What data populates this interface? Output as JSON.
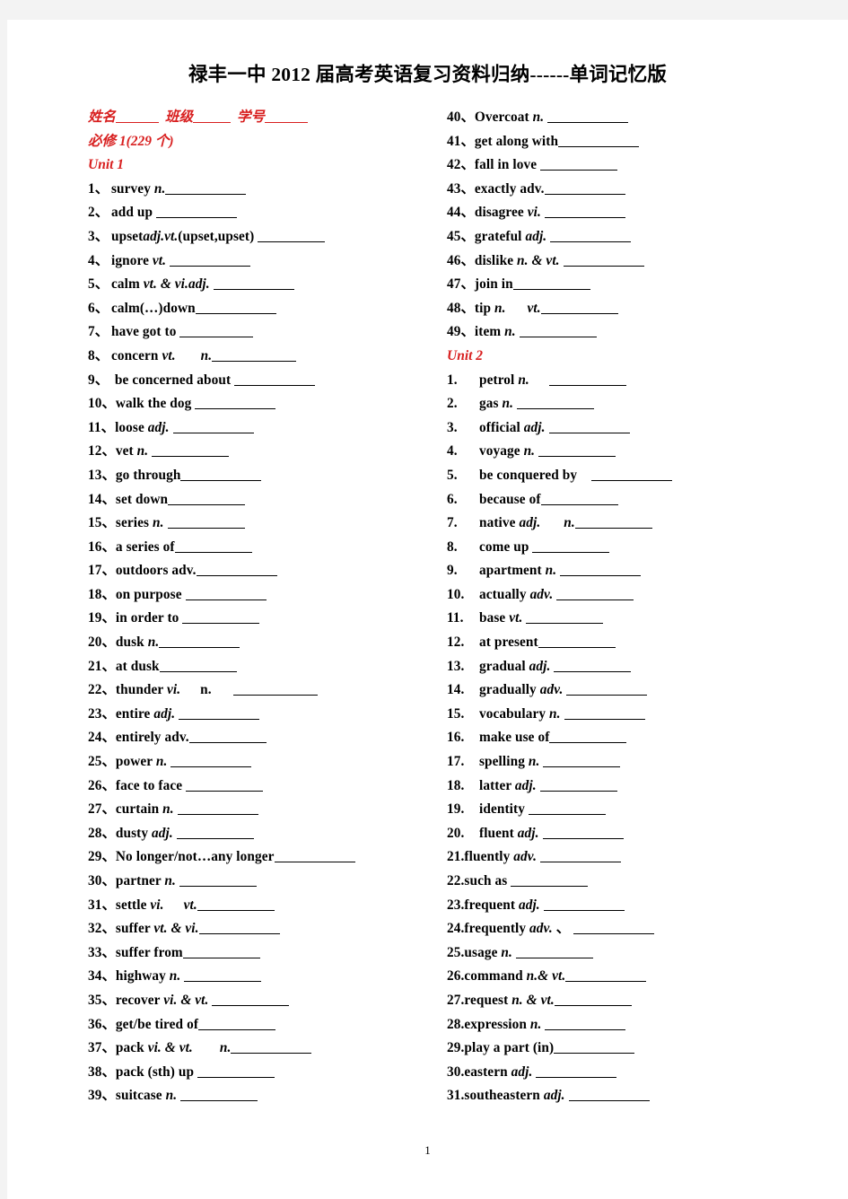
{
  "document": {
    "title": "禄丰一中 2012 届高考英语复习资料归纳------单词记忆版",
    "page_number": "1"
  },
  "meta": {
    "name_label": "姓名",
    "class_label": "班级",
    "student_id_label": "学号",
    "book_label": "必修 1(229 个)"
  },
  "units": {
    "unit1_label": "Unit 1",
    "unit2_label": "Unit 2"
  },
  "colors": {
    "accent_red": "#d81f1f",
    "text_black": "#000000",
    "page_white": "#ffffff",
    "surround_gray": "#f3f3f3"
  },
  "left_column": [
    {
      "num": "1、",
      "word": "survey ",
      "pos": "n.",
      "tail": "",
      "blank": 90,
      "gap": 0,
      "style": "dun"
    },
    {
      "num": "2、",
      "word": "add up ",
      "pos": "",
      "tail": "",
      "blank": 90,
      "gap": 0,
      "style": "dun"
    },
    {
      "num": "3、",
      "word": "upset",
      "pos": "adj.vt.",
      "tail": "(upset,upset) ",
      "blank": 75,
      "gap": 0,
      "style": "dun"
    },
    {
      "num": "4、",
      "word": "ignore ",
      "pos": "vt.",
      "tail": "",
      "blank": 90,
      "gap": 4,
      "style": "dun"
    },
    {
      "num": "5、",
      "word": "calm ",
      "pos": "vt. & vi.adj.",
      "tail": "",
      "blank": 90,
      "gap": 4,
      "style": "dun"
    },
    {
      "num": " 6、",
      "word": "calm(…)down",
      "pos": "",
      "tail": "",
      "blank": 90,
      "gap": 0,
      "style": "dun"
    },
    {
      "num": "7、",
      "word": "have got to ",
      "pos": "",
      "tail": "",
      "blank": 82,
      "gap": 0,
      "style": "dun"
    },
    {
      "num": "8、",
      "word": "concern ",
      "pos": "vt.",
      "tail": "",
      "blank": 94,
      "gap": 0,
      "style": "dun",
      "mid_pos": "n.",
      "mid_gap": 28
    },
    {
      "num": "9、",
      "word": "  be concerned about ",
      "pos": "",
      "tail": "",
      "blank": 90,
      "gap": 0,
      "style": "dun"
    },
    {
      "num": "10、",
      "word": "walk the dog ",
      "pos": "",
      "tail": "",
      "blank": 90,
      "gap": 0,
      "style": "dun"
    },
    {
      "num": "11、",
      "word": "loose ",
      "pos": "adj.",
      "tail": "",
      "blank": 90,
      "gap": 4,
      "style": "dun"
    },
    {
      "num": "12、",
      "word": "vet ",
      "pos": "n.",
      "tail": "",
      "blank": 86,
      "gap": 4,
      "style": "dun"
    },
    {
      "num": "13、",
      "word": "go through",
      "pos": "",
      "tail": "",
      "blank": 90,
      "gap": 0,
      "style": "dun"
    },
    {
      "num": "14、",
      "word": "set down",
      "pos": "",
      "tail": "",
      "blank": 86,
      "gap": 0,
      "style": "dun"
    },
    {
      "num": "15、",
      "word": "series ",
      "pos": "n.",
      "tail": "",
      "blank": 86,
      "gap": 4,
      "style": "dun"
    },
    {
      "num": "16、",
      "word": "a series of",
      "pos": "",
      "tail": "",
      "blank": 86,
      "gap": 0,
      "style": "dun"
    },
    {
      "num": "17、",
      "word": "outdoors adv.",
      "pos": "",
      "tail": "",
      "blank": 90,
      "gap": 0,
      "style": "dun"
    },
    {
      "num": "18、",
      "word": "on purpose ",
      "pos": "",
      "tail": "",
      "blank": 90,
      "gap": 0,
      "style": "dun"
    },
    {
      "num": "19、",
      "word": "in order to ",
      "pos": "",
      "tail": "",
      "blank": 86,
      "gap": 0,
      "style": "dun"
    },
    {
      "num": "20、",
      "word": "dusk ",
      "pos": "n.",
      "tail": "",
      "blank": 90,
      "gap": 0,
      "style": "dun"
    },
    {
      "num": "21、",
      "word": "at dusk",
      "pos": "",
      "tail": "",
      "blank": 86,
      "gap": 0,
      "style": "dun"
    },
    {
      "num": "22、",
      "word": "thunder ",
      "pos": "vi.",
      "tail": "",
      "blank": 94,
      "gap": 0,
      "style": "dun",
      "mid_pos": "n.",
      "mid_gap": 22,
      "mid_plain": true,
      "post_mid_gap": 24
    },
    {
      "num": "23、",
      "word": "entire ",
      "pos": "adj.",
      "tail": "",
      "blank": 90,
      "gap": 4,
      "style": "dun"
    },
    {
      "num": "24、",
      "word": "entirely adv.",
      "pos": "",
      "tail": "",
      "blank": 86,
      "gap": 0,
      "style": "dun"
    },
    {
      "num": "25、",
      "word": "power ",
      "pos": "n.",
      "tail": "",
      "blank": 90,
      "gap": 4,
      "style": "dun"
    },
    {
      "num": "26、",
      "word": "face to face ",
      "pos": "",
      "tail": "",
      "blank": 86,
      "gap": 0,
      "style": "dun"
    },
    {
      "num": "27、",
      "word": "curtain ",
      "pos": "n.",
      "tail": "",
      "blank": 90,
      "gap": 4,
      "style": "dun"
    },
    {
      "num": "28、",
      "word": "dusty ",
      "pos": "adj.",
      "tail": "",
      "blank": 86,
      "gap": 4,
      "style": "dun"
    },
    {
      "num": "29、",
      "word": "No longer/not…any longer",
      "pos": "",
      "tail": "",
      "blank": 90,
      "gap": 0,
      "style": "dun"
    },
    {
      "num": "30、",
      "word": "partner ",
      "pos": "n.",
      "tail": "",
      "blank": 86,
      "gap": 4,
      "style": "dun"
    },
    {
      "num": "31、",
      "word": "settle ",
      "pos": "vi.",
      "tail": "",
      "blank": 86,
      "gap": 0,
      "style": "dun",
      "mid_pos": "vt.",
      "mid_gap": 22
    },
    {
      "num": "32、",
      "word": "suffer ",
      "pos": "vt. & vi.",
      "tail": "",
      "blank": 90,
      "gap": 0,
      "style": "dun"
    },
    {
      "num": "33、",
      "word": "suffer from",
      "pos": "",
      "tail": "",
      "blank": 86,
      "gap": 0,
      "style": "dun"
    },
    {
      "num": "34、",
      "word": "highway ",
      "pos": "n.",
      "tail": "",
      "blank": 86,
      "gap": 4,
      "style": "dun"
    },
    {
      "num": "35、",
      "word": "recover ",
      "pos": "vi. & vt.",
      "tail": "",
      "blank": 86,
      "gap": 4,
      "style": "dun"
    },
    {
      "num": "36、",
      "word": "get/be tired of",
      "pos": "",
      "tail": "",
      "blank": 86,
      "gap": 0,
      "style": "dun"
    },
    {
      "num": "37、",
      "word": "pack ",
      "pos": "vi. & vt.",
      "tail": "",
      "blank": 90,
      "gap": 0,
      "style": "dun",
      "mid_pos": "n.",
      "mid_gap": 30
    },
    {
      "num": "38、",
      "word": "pack (sth) up ",
      "pos": "",
      "tail": "",
      "blank": 86,
      "gap": 0,
      "style": "dun"
    },
    {
      "num": "39、",
      "word": "suitcase ",
      "pos": "n.",
      "tail": "",
      "blank": 86,
      "gap": 4,
      "style": "dun"
    }
  ],
  "right_column_unit1": [
    {
      "num": "40、",
      "word": "Overcoat ",
      "pos": "n.",
      "tail": "",
      "blank": 90,
      "gap": 4,
      "style": "dun"
    },
    {
      "num": "41、",
      "word": "get along with",
      "pos": "",
      "tail": "",
      "blank": 90,
      "gap": 0,
      "style": "dun"
    },
    {
      "num": "42、",
      "word": "fall in love ",
      "pos": "",
      "tail": "",
      "blank": 86,
      "gap": 0,
      "style": "dun"
    },
    {
      "num": "43、",
      "word": "exactly adv.",
      "pos": "",
      "tail": "",
      "blank": 90,
      "gap": 0,
      "style": "dun"
    },
    {
      "num": "44、",
      "word": "disagree ",
      "pos": "vi.",
      "tail": "",
      "blank": 90,
      "gap": 4,
      "style": "dun"
    },
    {
      "num": "45、",
      "word": "grateful ",
      "pos": "adj.",
      "tail": "",
      "blank": 90,
      "gap": 4,
      "style": "dun"
    },
    {
      "num": "46、",
      "word": "dislike ",
      "pos": "n. & vt.",
      "tail": "",
      "blank": 90,
      "gap": 4,
      "style": "dun"
    },
    {
      "num": "47、",
      "word": "join in",
      "pos": "",
      "tail": "",
      "blank": 86,
      "gap": 0,
      "style": "dun"
    },
    {
      "num": "48、",
      "word": "tip ",
      "pos": "n.",
      "tail": "",
      "blank": 86,
      "gap": 0,
      "style": "dun",
      "mid_pos": "vt.",
      "mid_gap": 24
    },
    {
      "num": "49、",
      "word": "item ",
      "pos": "n.",
      "tail": "",
      "blank": 86,
      "gap": 4,
      "style": "dun"
    }
  ],
  "right_column_unit2": [
    {
      "num": "1.",
      "word": "petrol ",
      "pos": "n.",
      "tail": "",
      "blank": 86,
      "gap": 22,
      "style": "dot"
    },
    {
      "num": "2.",
      "word": "gas ",
      "pos": "n.",
      "tail": "",
      "blank": 86,
      "gap": 4,
      "style": "dot"
    },
    {
      "num": "3.",
      "word": "official ",
      "pos": "adj.",
      "tail": "",
      "blank": 90,
      "gap": 4,
      "style": "dot"
    },
    {
      "num": "4.",
      "word": "voyage ",
      "pos": "n.",
      "tail": "",
      "blank": 86,
      "gap": 4,
      "style": "dot"
    },
    {
      "num": "5.",
      "word": "be conquered by ",
      "pos": "",
      "tail": "",
      "blank": 90,
      "gap": 12,
      "style": "dot"
    },
    {
      "num": "6.",
      "word": "because of",
      "pos": "",
      "tail": "",
      "blank": 86,
      "gap": 0,
      "style": "dot"
    },
    {
      "num": "7.",
      "word": "native ",
      "pos": "adj.",
      "tail": "",
      "blank": 86,
      "gap": 0,
      "style": "dot",
      "mid_pos": "n.",
      "mid_gap": 26
    },
    {
      "num": "8.",
      "word": "come up ",
      "pos": "",
      "tail": "",
      "blank": 86,
      "gap": 0,
      "style": "dot"
    },
    {
      "num": "9.",
      "word": "apartment ",
      "pos": "n.",
      "tail": "",
      "blank": 90,
      "gap": 4,
      "style": "dot"
    },
    {
      "num": "10.",
      "word": "actually ",
      "pos": "adv.",
      "tail": "",
      "blank": 86,
      "gap": 4,
      "style": "dot"
    },
    {
      "num": "11.",
      "word": "base ",
      "pos": "vt.",
      "tail": "",
      "blank": 86,
      "gap": 4,
      "style": "dot"
    },
    {
      "num": "12.",
      "word": "at present",
      "pos": "",
      "tail": "",
      "blank": 86,
      "gap": 0,
      "style": "dot"
    },
    {
      "num": "13.",
      "word": "gradual ",
      "pos": "adj.",
      "tail": "",
      "blank": 86,
      "gap": 4,
      "style": "dot"
    },
    {
      "num": "14.",
      "word": "gradually ",
      "pos": "adv.",
      "tail": "",
      "blank": 90,
      "gap": 4,
      "style": "dot"
    },
    {
      "num": "15.",
      "word": "vocabulary ",
      "pos": "n.",
      "tail": "",
      "blank": 90,
      "gap": 4,
      "style": "dot"
    },
    {
      "num": "16.",
      "word": "make use of",
      "pos": "",
      "tail": "",
      "blank": 86,
      "gap": 0,
      "style": "dot"
    },
    {
      "num": "17.",
      "word": "spelling ",
      "pos": "n.",
      "tail": "",
      "blank": 86,
      "gap": 4,
      "style": "dot"
    },
    {
      "num": "18.",
      "word": "latter ",
      "pos": "adj.",
      "tail": "",
      "blank": 86,
      "gap": 4,
      "style": "dot"
    },
    {
      "num": "19.",
      "word": "identity ",
      "pos": "",
      "tail": "",
      "blank": 86,
      "gap": 0,
      "style": "dot"
    },
    {
      "num": "20.",
      "word": "fluent ",
      "pos": "adj.",
      "tail": "",
      "blank": 90,
      "gap": 4,
      "style": "dot"
    },
    {
      "num": "21.",
      "word": "fluently ",
      "pos": "adv.",
      "tail": "",
      "blank": 90,
      "gap": 4,
      "style": "tight"
    },
    {
      "num": "22.",
      "word": "such as ",
      "pos": "",
      "tail": "",
      "blank": 86,
      "gap": 0,
      "style": "tight"
    },
    {
      "num": "23.",
      "word": "frequent ",
      "pos": "adj.",
      "tail": "",
      "blank": 90,
      "gap": 4,
      "style": "tight"
    },
    {
      "num": "24.",
      "word": "frequently ",
      "pos": "adv.",
      "tail": " 、",
      "blank": 90,
      "gap": 4,
      "style": "tight"
    },
    {
      "num": "25.",
      "word": "usage ",
      "pos": "n.",
      "tail": "",
      "blank": 86,
      "gap": 4,
      "style": "tight"
    },
    {
      "num": "26.",
      "word": "command ",
      "pos": "n.& vt.",
      "tail": "",
      "blank": 90,
      "gap": 0,
      "style": "tight"
    },
    {
      "num": "27.",
      "word": "request ",
      "pos": "n. & vt.",
      "tail": "",
      "blank": 86,
      "gap": 0,
      "style": "tight"
    },
    {
      "num": "28.",
      "word": "expression ",
      "pos": "n.",
      "tail": "",
      "blank": 90,
      "gap": 4,
      "style": "tight"
    },
    {
      "num": "29.",
      "word": "play a part (in)",
      "pos": "",
      "tail": "",
      "blank": 90,
      "gap": 0,
      "style": "tight"
    },
    {
      "num": "30.",
      "word": "eastern ",
      "pos": "adj.",
      "tail": "",
      "blank": 90,
      "gap": 4,
      "style": "tight"
    },
    {
      "num": "31.",
      "word": "southeastern ",
      "pos": "adj.",
      "tail": "",
      "blank": 90,
      "gap": 4,
      "style": "tight"
    }
  ]
}
